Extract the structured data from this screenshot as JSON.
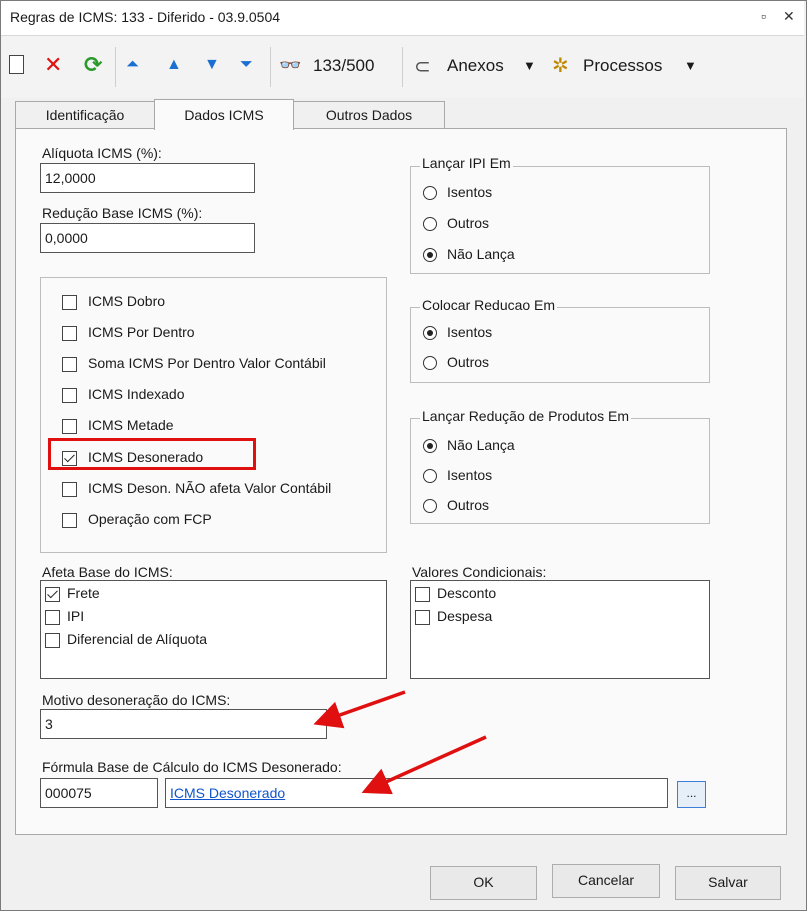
{
  "window": {
    "title": "Regras de ICMS: 133 - Diferido - 03.9.0504",
    "restore_glyph": "▫",
    "close_glyph": "✕"
  },
  "toolbar": {
    "record_counter": "133/500",
    "attachments_label": "Anexos",
    "processes_label": "Processos",
    "icons": [
      "new-doc-icon",
      "delete-icon",
      "refresh-icon",
      "first-icon",
      "prev-icon",
      "next-icon",
      "last-icon",
      "binoculars-icon",
      "paperclip-icon",
      "gear-icon"
    ]
  },
  "tabs": [
    {
      "label": "Identificação"
    },
    {
      "label": "Dados ICMS"
    },
    {
      "label": "Outros Dados"
    }
  ],
  "aliquota": {
    "label": "Alíquota ICMS (%):",
    "value": "12,0000"
  },
  "reducao": {
    "label": "Redução Base ICMS (%):",
    "value": "0,0000"
  },
  "options": [
    {
      "label": "ICMS Dobro",
      "checked": false
    },
    {
      "label": "ICMS Por Dentro",
      "checked": false
    },
    {
      "label": "Soma ICMS Por Dentro Valor Contábil",
      "checked": false
    },
    {
      "label": "ICMS Indexado",
      "checked": false
    },
    {
      "label": "ICMS Metade",
      "checked": false
    },
    {
      "label": "ICMS Desonerado",
      "checked": true
    },
    {
      "label": "ICMS Deson. NÃO afeta Valor Contábil",
      "checked": false
    },
    {
      "label": "Operação com FCP",
      "checked": false
    }
  ],
  "lancar_ipi": {
    "legend": "Lançar IPI Em",
    "options": [
      "Isentos",
      "Outros",
      "Não Lança"
    ],
    "selected": 2
  },
  "colocar_reducao": {
    "legend": "Colocar Reducao Em",
    "options": [
      "Isentos",
      "Outros"
    ],
    "selected": 0
  },
  "lancar_reducao": {
    "legend": "Lançar Redução de Produtos Em",
    "options": [
      "Não Lança",
      "Isentos",
      "Outros"
    ],
    "selected": 0
  },
  "afeta_base": {
    "label": "Afeta Base do ICMS:",
    "items": [
      {
        "label": "Frete",
        "checked": true
      },
      {
        "label": "IPI",
        "checked": false
      },
      {
        "label": "Diferencial de Alíquota",
        "checked": false
      }
    ]
  },
  "valores": {
    "label": "Valores Condicionais:",
    "items": [
      {
        "label": "Desconto",
        "checked": false
      },
      {
        "label": "Despesa",
        "checked": false
      }
    ]
  },
  "motivo": {
    "label": "Motivo desoneração do ICMS:",
    "value": "3"
  },
  "formula": {
    "label": "Fórmula Base de Cálculo do ICMS Desonerado:",
    "code": "000075",
    "name": "ICMS Desonerado",
    "browse": "..."
  },
  "buttons": {
    "ok": "OK",
    "cancel": "Cancelar",
    "save": "Salvar"
  },
  "colors": {
    "highlight": "#e01010",
    "arrow": "#e01010",
    "link": "#1155cc"
  }
}
